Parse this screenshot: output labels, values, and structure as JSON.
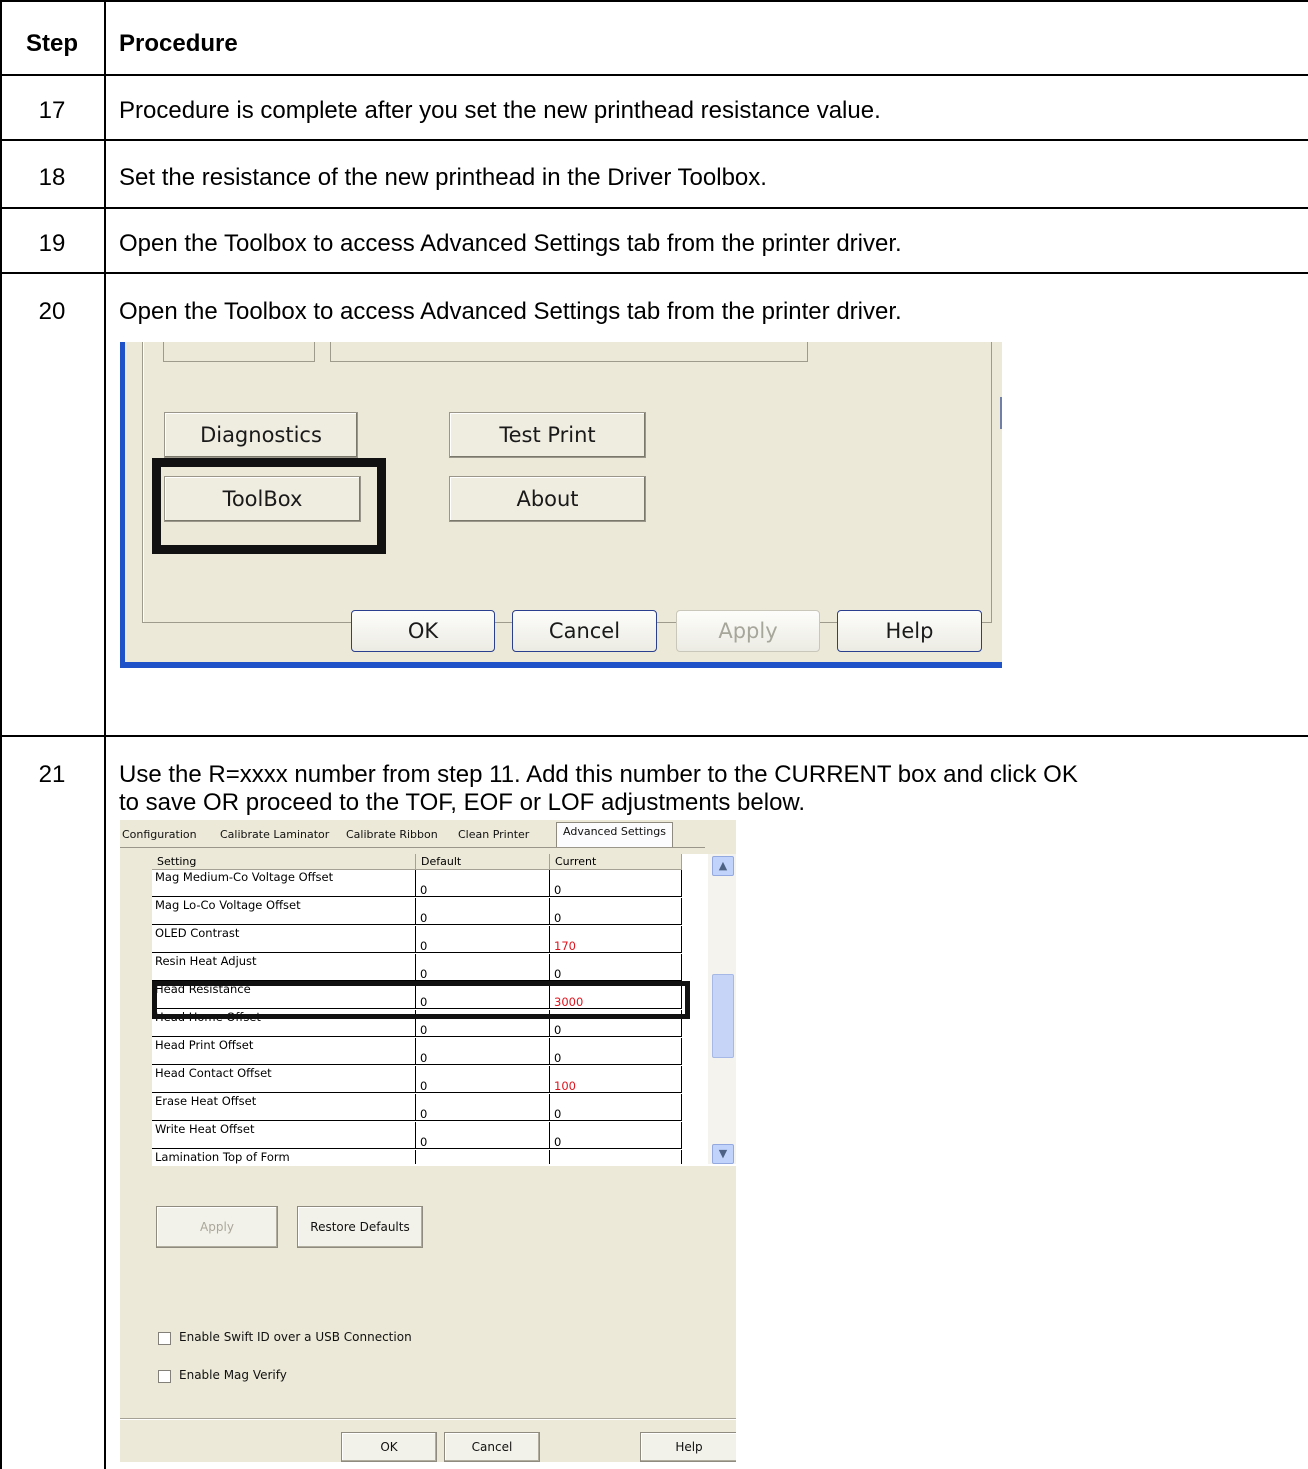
{
  "table": {
    "header": {
      "step": "Step",
      "procedure": "Procedure"
    },
    "rows": [
      {
        "step": "17",
        "text": "Procedure is complete after you set the new printhead resistance value."
      },
      {
        "step": "18",
        "text": "Set the resistance of the new printhead in the Driver Toolbox."
      },
      {
        "step": "19",
        "text": "Open the Toolbox to access Advanced Settings tab from the printer driver."
      },
      {
        "step": "20",
        "text": "Open the Toolbox to access Advanced Settings tab from the printer driver."
      },
      {
        "step": "21",
        "text_line1": "Use the R=xxxx number from step 11.  Add this number to the CURRENT box and click OK",
        "text_line2": "to save OR proceed to the TOF, EOF or LOF adjustments below."
      }
    ]
  },
  "dialog1": {
    "buttons": {
      "diagnostics": "Diagnostics",
      "test_print": "Test Print",
      "toolbox": "ToolBox",
      "about": "About",
      "ok": "OK",
      "cancel": "Cancel",
      "apply": "Apply",
      "help": "Help"
    }
  },
  "dialog2": {
    "tabs": [
      "Configuration",
      "Calibrate Laminator",
      "Calibrate Ribbon",
      "Clean Printer",
      "Advanced Settings"
    ],
    "columns": {
      "setting": "Setting",
      "default": "Default",
      "current": "Current"
    },
    "settings": [
      {
        "name": "Mag Medium-Co Voltage Offset",
        "default": "0",
        "current": "0",
        "changed": false
      },
      {
        "name": "Mag Lo-Co Voltage Offset",
        "default": "0",
        "current": "0",
        "changed": false
      },
      {
        "name": "OLED Contrast",
        "default": "0",
        "current": "170",
        "changed": true
      },
      {
        "name": "Resin Heat Adjust",
        "default": "0",
        "current": "0",
        "changed": false
      },
      {
        "name": "Head Resistance",
        "default": "0",
        "current": "3000",
        "changed": true
      },
      {
        "name": "Head Home Offset",
        "default": "0",
        "current": "0",
        "changed": false
      },
      {
        "name": "Head Print Offset",
        "default": "0",
        "current": "0",
        "changed": false
      },
      {
        "name": "Head Contact Offset",
        "default": "0",
        "current": "100",
        "changed": true
      },
      {
        "name": "Erase Heat Offset",
        "default": "0",
        "current": "0",
        "changed": false
      },
      {
        "name": "Write Heat Offset",
        "default": "0",
        "current": "0",
        "changed": false
      },
      {
        "name": "Lamination Top of Form",
        "default": "",
        "current": "",
        "changed": false
      }
    ],
    "buttons": {
      "apply": "Apply",
      "restore_defaults": "Restore Defaults",
      "ok": "OK",
      "cancel": "Cancel",
      "help": "Help"
    },
    "checkboxes": [
      {
        "label": "Enable Swift ID over a USB Connection",
        "checked": false
      },
      {
        "label": "Enable Mag Verify",
        "checked": false
      }
    ],
    "colors": {
      "changed_value": "#e0141e"
    }
  }
}
